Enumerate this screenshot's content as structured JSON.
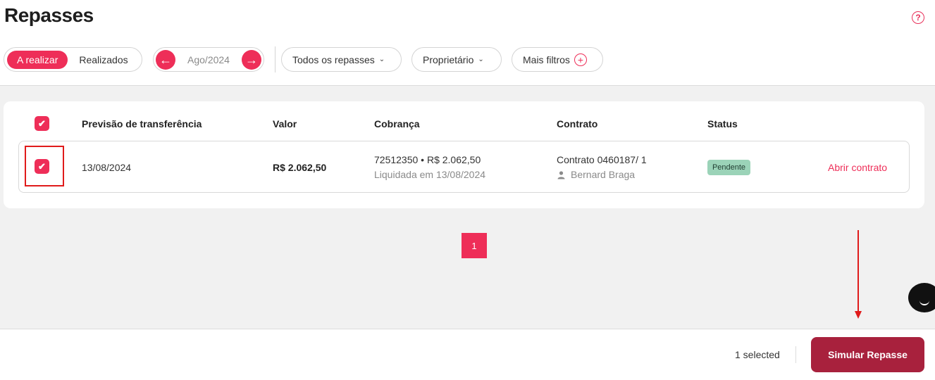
{
  "header": {
    "title": "Repasses",
    "help_icon": "?"
  },
  "filters": {
    "tab_active": "A realizar",
    "tab_inactive": "Realizados",
    "prev_arrow": "←",
    "month": "Ago/2024",
    "next_arrow": "→",
    "type_filter": "Todos os repasses",
    "owner_filter": "Proprietário",
    "more_filters": "Mais filtros",
    "chevron": "⌄",
    "plus": "+"
  },
  "table": {
    "columns": [
      "Previsão de transferência",
      "Valor",
      "Cobrança",
      "Contrato",
      "Status"
    ],
    "rows": [
      {
        "checked": true,
        "date": "13/08/2024",
        "value": "R$ 2.062,50",
        "charge_line1": "72512350 • R$ 2.062,50",
        "charge_line2": "Liquidada em 13/08/2024",
        "contract": "Contrato 0460187/ 1",
        "owner": "Bernard Braga",
        "status": "Pendente",
        "action": "Abrir contrato"
      }
    ],
    "check_glyph": "✔"
  },
  "pagination": {
    "current_page": "1"
  },
  "footer": {
    "selected_text": "1 selected",
    "primary_button": "Simular Repasse"
  },
  "colors": {
    "accent": "#ee2e58",
    "primary_button": "#a8213d",
    "status_badge": "#9bd3b8",
    "annotation": "#e01b1b"
  }
}
